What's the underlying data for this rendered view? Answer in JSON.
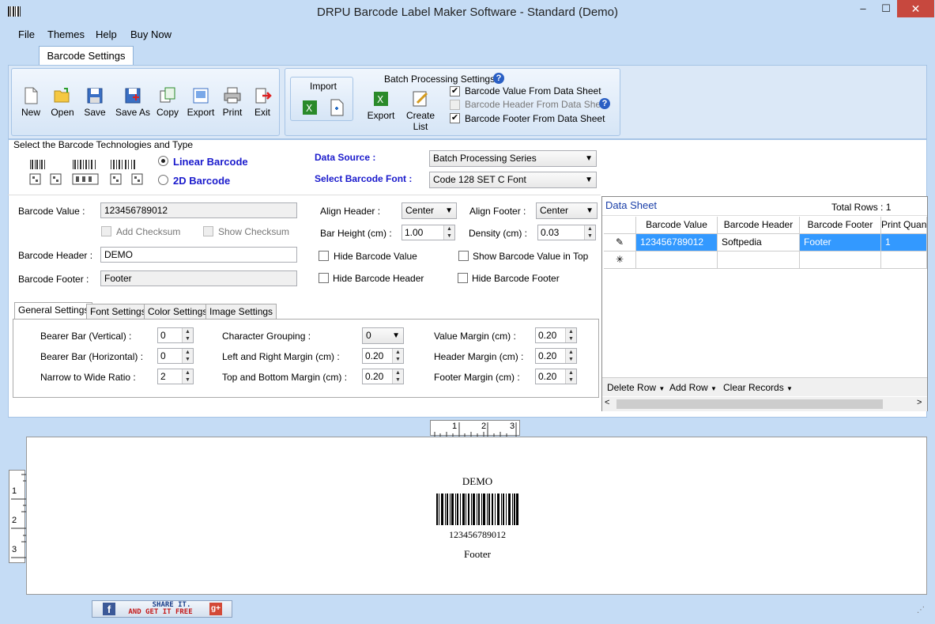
{
  "window": {
    "title": "DRPU Barcode Label Maker Software - Standard (Demo)",
    "min": "–",
    "max": "☐",
    "close": "✕"
  },
  "menu": [
    "File",
    "Themes",
    "Help",
    "Buy Now"
  ],
  "tab": "Barcode Settings",
  "toolbar": {
    "buttons": [
      "New",
      "Open",
      "Save",
      "Save As",
      "Copy",
      "Export",
      "Print",
      "Exit"
    ],
    "import_label": "Import",
    "batch_title": "Batch Processing Settings",
    "batch_export": "Export",
    "batch_create_list": "Create List",
    "chk_value": "Barcode Value From Data Sheet",
    "chk_header": "Barcode Header From Data Sheet",
    "chk_footer": "Barcode Footer From Data Sheet"
  },
  "tech": {
    "title": "Select the Barcode Technologies and Type",
    "linear": "Linear Barcode",
    "twod": "2D Barcode",
    "data_source_label": "Data Source :",
    "data_source_value": "Batch Processing Series",
    "font_label": "Select Barcode Font :",
    "font_value": "Code 128 SET C Font"
  },
  "form": {
    "value_label": "Barcode Value :",
    "value": "123456789012",
    "add_checksum": "Add Checksum",
    "show_checksum": "Show Checksum",
    "header_label": "Barcode Header :",
    "header": "DEMO",
    "footer_label": "Barcode Footer :",
    "footer": "Footer",
    "align_header_label": "Align Header  :",
    "align_header": "Center",
    "align_footer_label": "Align Footer  :",
    "align_footer": "Center",
    "bar_height_label": "Bar Height (cm) :",
    "bar_height": "1.00",
    "density_label": "Density (cm) :",
    "density": "0.03",
    "hide_value": "Hide Barcode Value",
    "show_value_top": "Show Barcode Value in Top",
    "hide_header": "Hide Barcode Header",
    "hide_footer": "Hide Barcode Footer"
  },
  "subtabs": [
    "General Settings",
    "Font Settings",
    "Color Settings",
    "Image Settings"
  ],
  "general": {
    "bearer_v_label": "Bearer Bar (Vertical) :",
    "bearer_v": "0",
    "bearer_h_label": "Bearer Bar (Horizontal) :",
    "bearer_h": "0",
    "ratio_label": "Narrow to Wide Ratio :",
    "ratio": "2",
    "char_group_label": "Character Grouping  :",
    "char_group": "0",
    "lr_margin_label": "Left and Right Margin (cm) :",
    "lr_margin": "0.20",
    "tb_margin_label": "Top and Bottom Margin (cm) :",
    "tb_margin": "0.20",
    "value_margin_label": "Value Margin (cm) :",
    "value_margin": "0.20",
    "header_margin_label": "Header Margin (cm) :",
    "header_margin": "0.20",
    "footer_margin_label": "Footer Margin (cm) :",
    "footer_margin": "0.20"
  },
  "datasheet": {
    "title": "Data Sheet",
    "total_rows": "Total Rows : 1",
    "columns": [
      "Barcode Value",
      "Barcode Header",
      "Barcode Footer",
      "Print Quant"
    ],
    "row": [
      "123456789012",
      "Softpedia",
      "Footer",
      "1"
    ],
    "delete_row": "Delete Row",
    "add_row": "Add Row",
    "clear_records": "Clear Records"
  },
  "preview": {
    "header": "DEMO",
    "value": "123456789012",
    "footer": "Footer",
    "ruler_h": [
      "1",
      "2",
      "3"
    ],
    "ruler_v": [
      "1",
      "2",
      "3"
    ]
  },
  "status": {
    "share_line1": "SHARE IT.",
    "share_line2": "AND GET IT FREE"
  }
}
